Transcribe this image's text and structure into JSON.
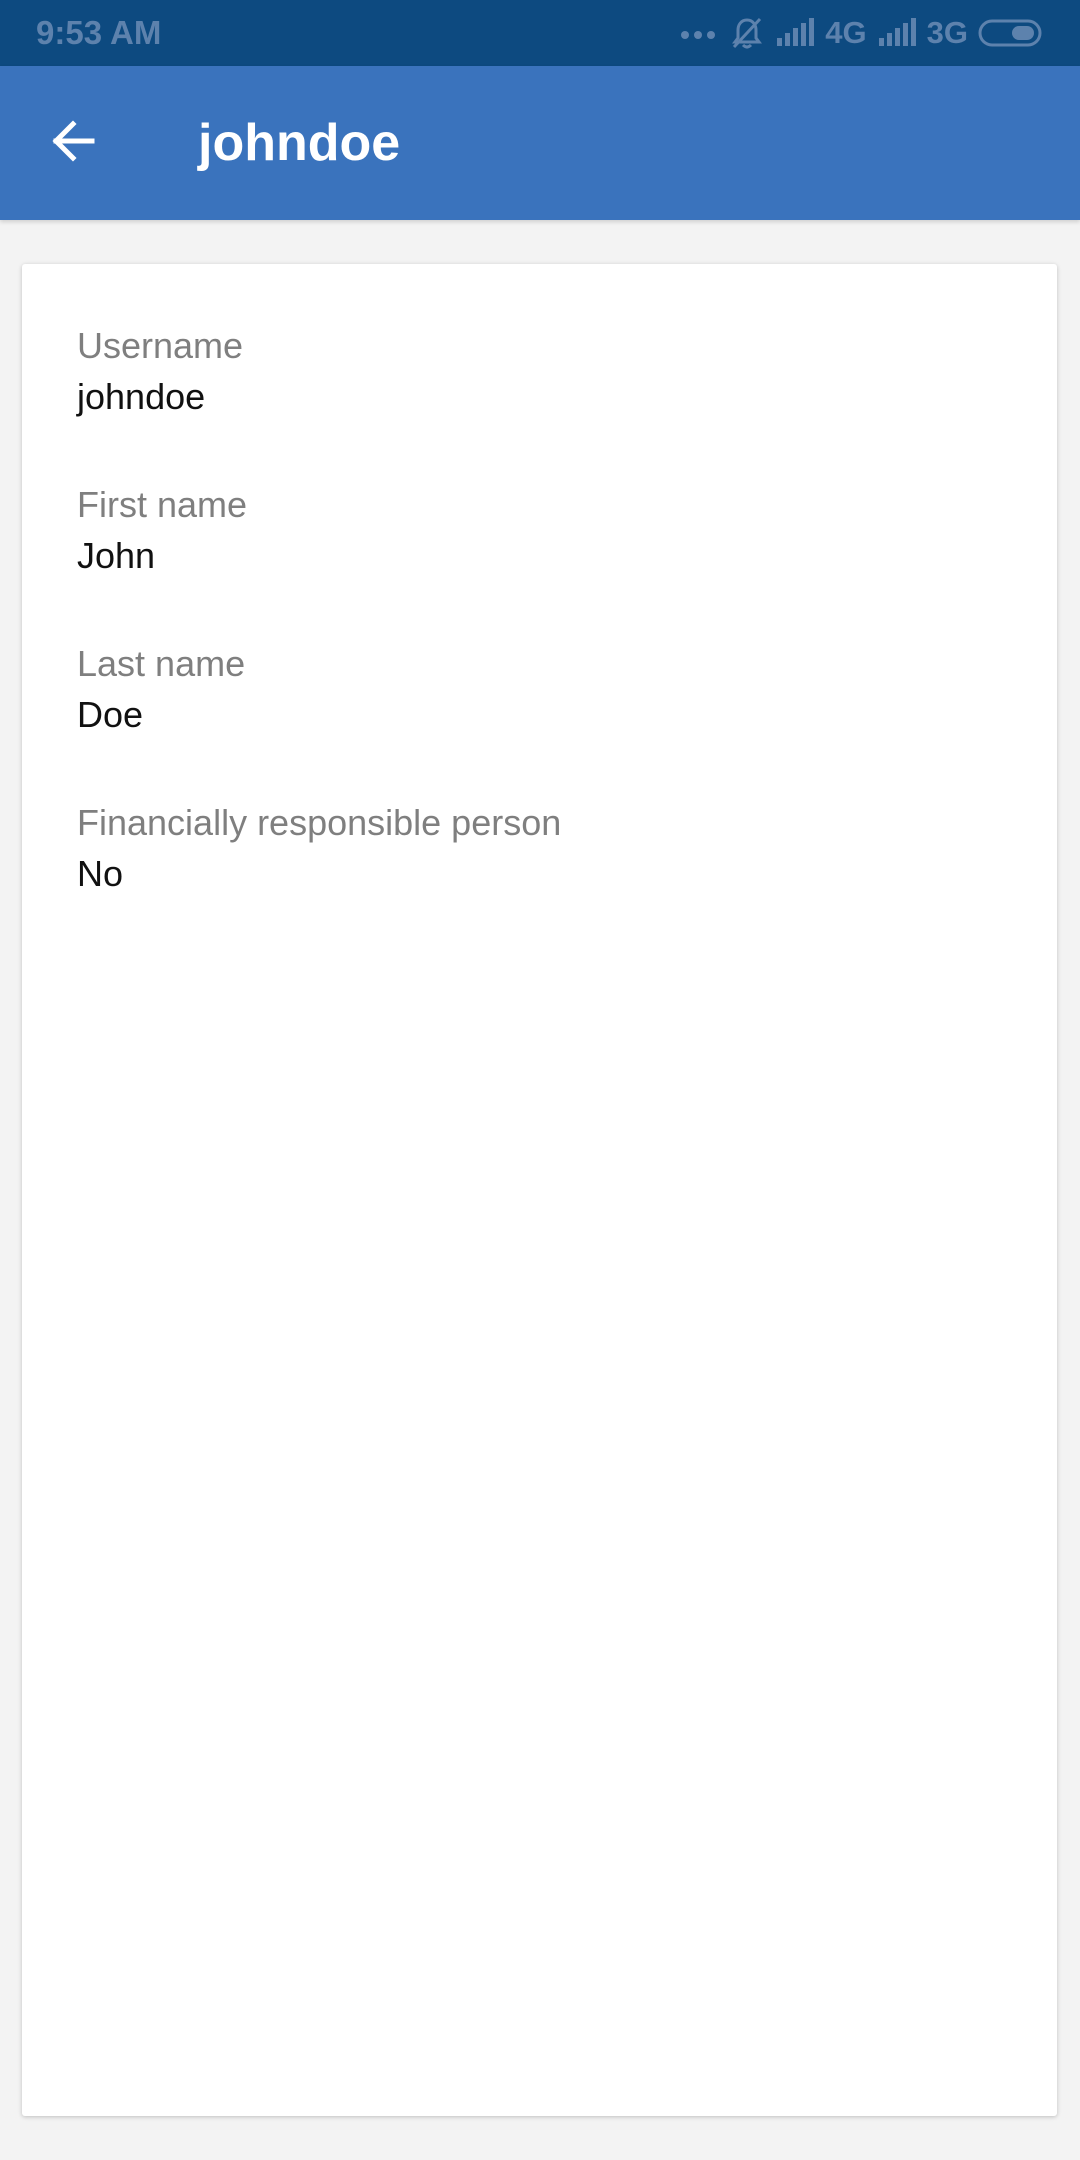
{
  "status_bar": {
    "time": "9:53 AM",
    "network_1": "4G",
    "network_2": "3G",
    "icons": [
      "more-dots-icon",
      "notifications-off-icon",
      "signal-icon",
      "signal-icon",
      "battery-icon"
    ]
  },
  "app_bar": {
    "title": "johndoe",
    "back_icon": "arrow-back-icon",
    "background_color": "#3a73bd"
  },
  "details": {
    "fields": [
      {
        "label": "Username",
        "value": "johndoe"
      },
      {
        "label": "First name",
        "value": "John"
      },
      {
        "label": "Last name",
        "value": "Doe"
      },
      {
        "label": "Financially responsible person",
        "value": "No"
      }
    ]
  }
}
